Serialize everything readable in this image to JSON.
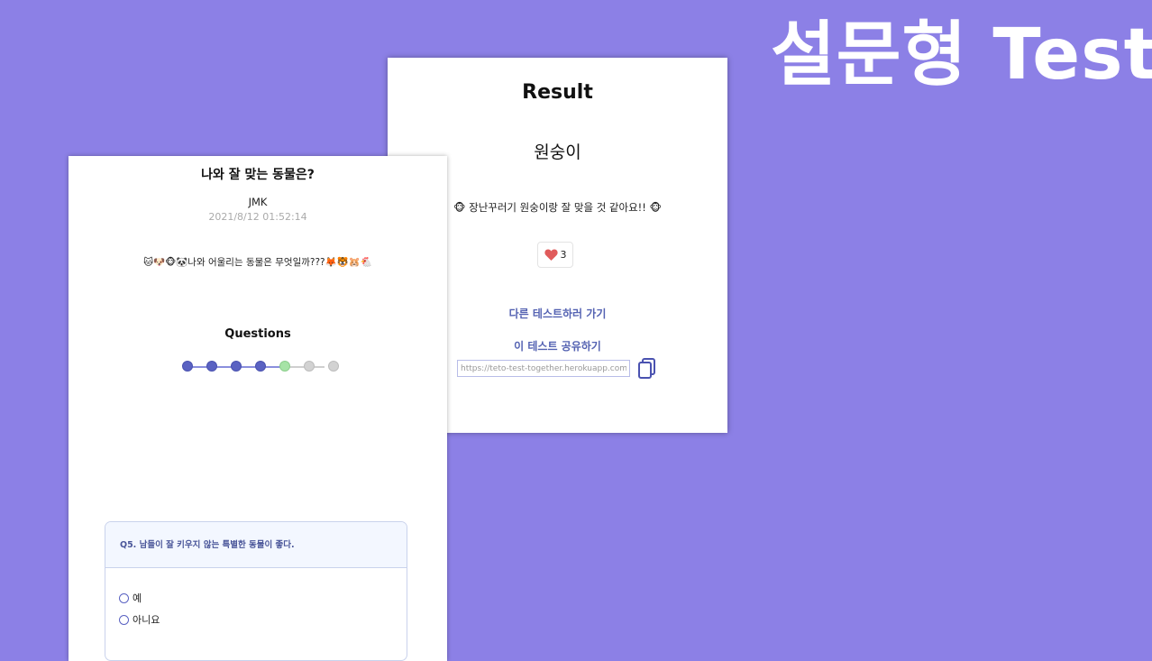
{
  "banner": {
    "title": "설문형 Test"
  },
  "result_card": {
    "heading": "Result",
    "result_name": "원숭이",
    "description": "🐵 장난꾸러기 원숭이랑 잘 맞을 것 같아요!! 🐵",
    "like_count": "3",
    "other_test_link": "다른 테스트하러 가기",
    "share_title": "이 테스트 공유하기",
    "share_url": "https://teto-test-together.herokuapp.com/s"
  },
  "test_card": {
    "title": "나와 잘 맞는 동물은?",
    "author": "JMK",
    "date": "2021/8/12 01:52:14",
    "description": "🐱🐶🐵🐼나와 어울리는 동물은 무엇일까???🦊🐯🐹🐔",
    "questions_heading": "Questions",
    "progress": {
      "total": 7,
      "completed": 4,
      "current": 5
    },
    "question": {
      "text": "Q5. 남들이 잘 키우지 않는 특별한 동물이 좋다.",
      "options": [
        {
          "label": "예"
        },
        {
          "label": "아니요"
        }
      ]
    }
  },
  "colors": {
    "background": "#8c80e6",
    "accent": "#5a62c2",
    "link": "#5462b2",
    "current_step": "#a6e3a6",
    "heart": "#e05b5b"
  }
}
